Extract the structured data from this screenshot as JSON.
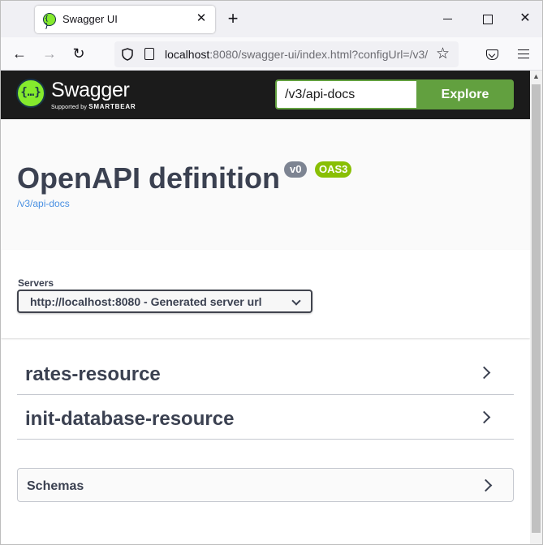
{
  "browser": {
    "tab_title": "Swagger UI",
    "tab_close_glyph": "✕",
    "new_tab_glyph": "+",
    "close_glyph": "✕",
    "back_glyph": "←",
    "forward_glyph": "→",
    "reload_glyph": "↻",
    "star_glyph": "☆",
    "url_host": "localhost",
    "url_rest": ":8080/swagger-ui/index.html?configUrl=/v3/"
  },
  "swagger": {
    "logo_glyph": "{…}",
    "brand_name": "Swagger",
    "supported_by": "Supported by",
    "smartbear": "SMARTBEAR",
    "spec_url_value": "/v3/api-docs",
    "explore_label": "Explore",
    "api_title": "OpenAPI definition",
    "version_badge": "v0",
    "oas_badge": "OAS3",
    "spec_link": "/v3/api-docs",
    "servers_label": "Servers",
    "selected_server": "http://localhost:8080 - Generated server url",
    "tags": [
      {
        "name": "rates-resource"
      },
      {
        "name": "init-database-resource"
      }
    ],
    "schemas_label": "Schemas"
  },
  "colors": {
    "topbar": "#1b1b1b",
    "accent_green": "#62a03f",
    "logo_green": "#85ea2d",
    "oas_badge": "#89bf04",
    "version_badge": "#7d8492",
    "link_blue": "#4990e2",
    "text_dark": "#3b4151"
  }
}
